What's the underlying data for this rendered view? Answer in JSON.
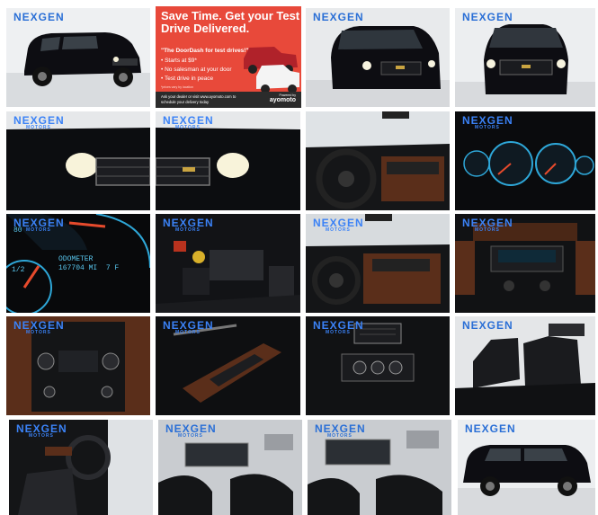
{
  "watermark": {
    "brand": "NEXGEN",
    "sub": "MOTORS"
  },
  "ad": {
    "headline": "Save Time. Get your Test Drive Delivered.",
    "quote": "\"The DoorDash for test drives!\"",
    "bullets": [
      "Starts at $9*",
      "No salesman at your door",
      "Test drive in peace"
    ],
    "fine_print": "*prices vary by location",
    "cta": "Ask your dealer or visit www.ayomoto.com to schedule your delivery today",
    "powered_by": "Powered by",
    "powered_brand": "ayomoto"
  },
  "odometer": {
    "label": "ODOMETER",
    "value": "167704 MI",
    "temp": "7  F",
    "gauge_top": "80",
    "gauge_left": "1/2"
  },
  "colors": {
    "accent": "#2a6fd6",
    "ad_bg": "#e8493a",
    "vehicle": "#0d0d12"
  },
  "tiles": [
    {
      "id": "t1",
      "icon": "suv-front-quarter-photo"
    },
    {
      "id": "t2",
      "icon": "test-drive-ad-banner"
    },
    {
      "id": "t3",
      "icon": "suv-front-angle-photo"
    },
    {
      "id": "t4",
      "icon": "suv-front-photo"
    },
    {
      "id": "t5",
      "icon": "headlight-detail-photo"
    },
    {
      "id": "t6",
      "icon": "headlight-right-detail-photo"
    },
    {
      "id": "t7",
      "icon": "dashboard-steering-photo"
    },
    {
      "id": "t8",
      "icon": "instrument-cluster-photo"
    },
    {
      "id": "t9",
      "icon": "odometer-closeup-photo"
    },
    {
      "id": "t10",
      "icon": "engine-bay-photo"
    },
    {
      "id": "t11",
      "icon": "dashboard-wide-photo"
    },
    {
      "id": "t12",
      "icon": "center-console-radio-photo"
    },
    {
      "id": "t13",
      "icon": "climate-controls-photo"
    },
    {
      "id": "t14",
      "icon": "door-switches-photo"
    },
    {
      "id": "t15",
      "icon": "rear-climate-controls-photo"
    },
    {
      "id": "t16",
      "icon": "rear-seats-photo"
    },
    {
      "id": "t17",
      "icon": "driver-door-interior-photo"
    },
    {
      "id": "t18",
      "icon": "sunroof-interior-photo"
    },
    {
      "id": "t19",
      "icon": "sunroof-interior-alt-photo"
    },
    {
      "id": "t20",
      "icon": "suv-side-profile-photo"
    }
  ]
}
